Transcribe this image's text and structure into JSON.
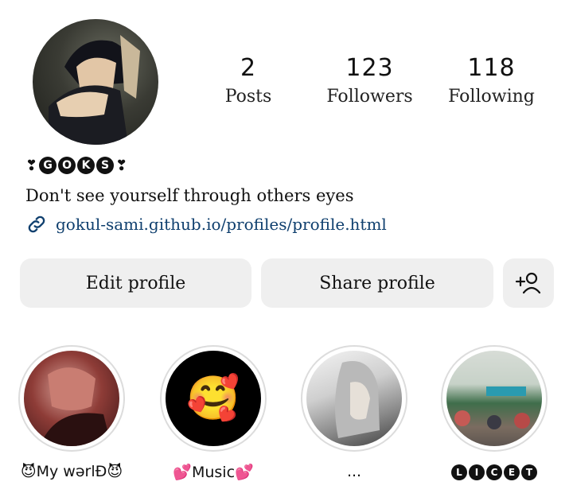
{
  "profile": {
    "name_letters": [
      "G",
      "O",
      "K",
      "S"
    ],
    "name_decor": "❣",
    "bio": "Don't see yourself through others eyes",
    "link": "gokul-sami.github.io/profiles/profile.html",
    "link_icon": "link-icon"
  },
  "stats": {
    "posts": {
      "value": "2",
      "label": "Posts"
    },
    "followers": {
      "value": "123",
      "label": "Followers"
    },
    "following": {
      "value": "118",
      "label": "Following"
    }
  },
  "actions": {
    "edit_label": "Edit profile",
    "share_label": "Share profile",
    "add_user_icon": "add-user-icon"
  },
  "highlights": [
    {
      "label": "😈My wərlÐ😈"
    },
    {
      "label": "💕Music💕",
      "emoji": "🥰"
    },
    {
      "label": "..."
    },
    {
      "label_letters": [
        "L",
        "I",
        "C",
        "E",
        "T"
      ]
    }
  ]
}
